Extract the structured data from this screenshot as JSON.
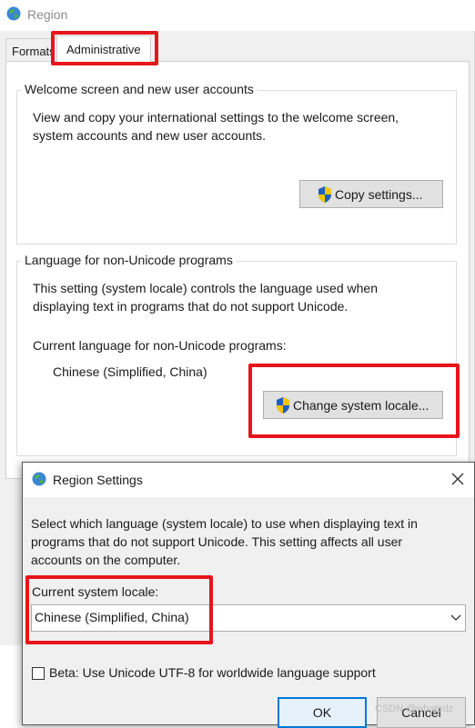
{
  "region_window": {
    "title": "Region",
    "tabs": [
      {
        "label": "Formats"
      },
      {
        "label": "Administrative"
      }
    ],
    "welcome_group": {
      "title": "Welcome screen and new user accounts",
      "description_line1": "View and copy your international settings to the welcome screen,",
      "description_line2": "system accounts and new user accounts.",
      "copy_button": "Copy settings..."
    },
    "non_unicode_group": {
      "title": "Language for non-Unicode programs",
      "description_line1": "This setting (system locale) controls the language used when",
      "description_line2": "displaying text in programs that do not support Unicode.",
      "current_label": "Current language for non-Unicode programs:",
      "current_value": "Chinese (Simplified, China)",
      "change_button": "Change system locale..."
    }
  },
  "dialog": {
    "title": "Region Settings",
    "description_line1": "Select which language (system locale) to use when displaying text in",
    "description_line2": "programs that do not support Unicode. This setting affects all user",
    "description_line3": "accounts on the computer.",
    "current_label": "Current system locale:",
    "selected_locale": "Chinese (Simplified, China)",
    "beta_checkbox_label": "Beta: Use Unicode UTF-8 for worldwide language support",
    "beta_checked": false,
    "ok_button": "OK",
    "cancel_button": "Cancel"
  },
  "watermark": "CSDN @whatedz",
  "colors": {
    "highlight_red": "#e8141b",
    "focus_blue": "#0078d7"
  },
  "icons": {
    "app": "globe-icon",
    "button": "uac-shield-icon",
    "close": "close-icon",
    "dropdown": "chevron-down-icon"
  }
}
